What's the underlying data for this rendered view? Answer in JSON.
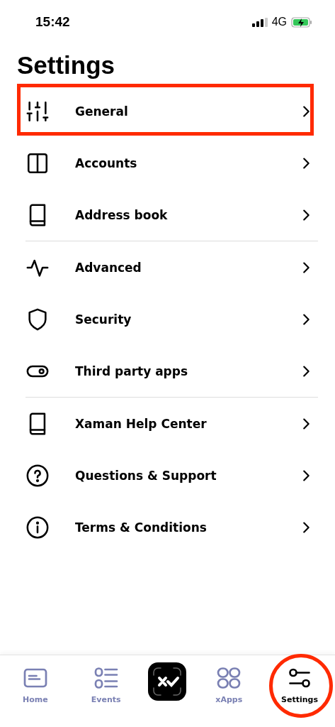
{
  "status_bar": {
    "time": "15:42",
    "network": "4G",
    "charging": true
  },
  "title": "Settings",
  "sections": [
    {
      "items": [
        {
          "label": "General",
          "highlighted": true
        },
        {
          "label": "Accounts",
          "highlighted": false
        },
        {
          "label": "Address book",
          "highlighted": false
        }
      ]
    },
    {
      "items": [
        {
          "label": "Advanced",
          "highlighted": false
        },
        {
          "label": "Security",
          "highlighted": false
        },
        {
          "label": "Third party apps",
          "highlighted": false
        }
      ]
    },
    {
      "items": [
        {
          "label": "Xaman Help Center",
          "highlighted": false
        },
        {
          "label": "Questions & Support",
          "highlighted": false
        },
        {
          "label": "Terms & Conditions",
          "highlighted": false
        }
      ]
    }
  ],
  "tab_bar": [
    {
      "kind": "tab",
      "label": "Home",
      "selected": false,
      "highlighted": false
    },
    {
      "kind": "tab",
      "label": "Events",
      "selected": false,
      "highlighted": false
    },
    {
      "kind": "scan"
    },
    {
      "kind": "tab",
      "label": "xApps",
      "selected": false,
      "highlighted": false
    },
    {
      "kind": "tab",
      "label": "Settings",
      "selected": true,
      "highlighted": true
    }
  ]
}
